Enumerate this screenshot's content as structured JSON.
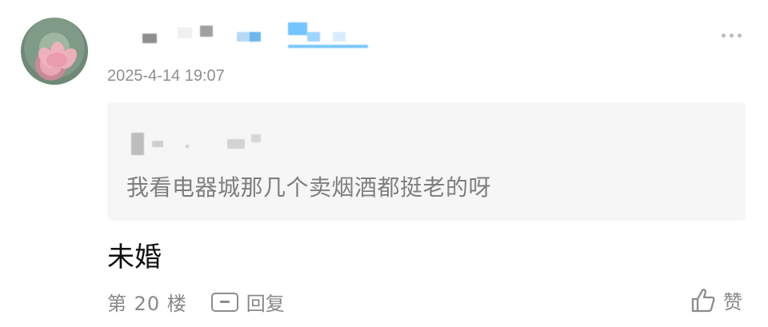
{
  "post": {
    "timestamp": "2025-4-14 19:07",
    "quote": {
      "text": "我看电器城那几个卖烟酒都挺老的呀"
    },
    "reply_text": "未婚",
    "footer": {
      "floor": "第 20 楼",
      "reply_label": "回复",
      "like_label": "赞"
    }
  },
  "colors": {
    "quote_bg": "#f6f6f6",
    "muted_text": "#888888",
    "blur_accent": "#56b4f1"
  },
  "icons": [
    "more-icon",
    "reply-icon",
    "thumbs-up-icon"
  ]
}
